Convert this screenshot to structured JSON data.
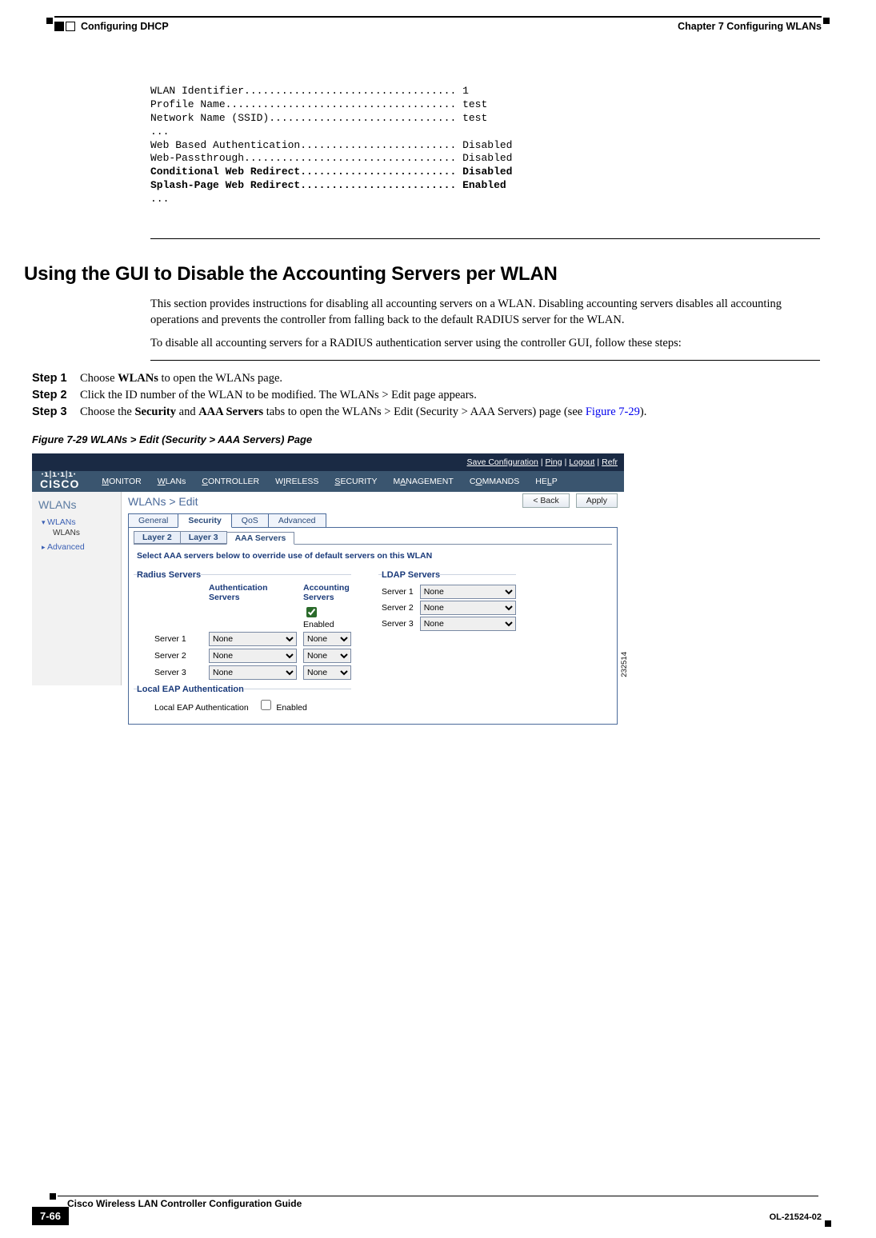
{
  "header": {
    "chapter": "Chapter 7      Configuring WLANs",
    "section": "Configuring DHCP"
  },
  "cli": {
    "plain": "WLAN Identifier.................................. 1\nProfile Name..................................... test\nNetwork Name (SSID).............................. test\n...\nWeb Based Authentication......................... Disabled\nWeb-Passthrough.................................. Disabled",
    "bold": "Conditional Web Redirect......................... Disabled\nSplash-Page Web Redirect......................... Enabled",
    "tail": "..."
  },
  "title": "Using the GUI to Disable the Accounting Servers per WLAN",
  "para1": "This section provides instructions for disabling all accounting servers on a WLAN. Disabling accounting servers disables all accounting operations and prevents the controller from falling back to the default RADIUS server for the WLAN.",
  "para2": "To disable all accounting servers for a RADIUS authentication server using the controller GUI, follow these steps:",
  "steps": {
    "s1l": "Step 1",
    "s1t_a": "Choose ",
    "s1t_b": "WLANs",
    "s1t_c": " to open the WLANs page.",
    "s2l": "Step 2",
    "s2t": "Click the ID number of the WLAN to be modified. The WLANs > Edit page appears.",
    "s3l": "Step 3",
    "s3t_a": "Choose the ",
    "s3t_b": "Security",
    "s3t_c": " and ",
    "s3t_d": "AAA Servers",
    "s3t_e": " tabs to open the WLANs > Edit (Security > AAA Servers) page (see ",
    "s3t_link": "Figure 7-29",
    "s3t_f": ")."
  },
  "figcap": "Figure 7-29   WLANs > Edit (Security > AAA Servers) Page",
  "fig": {
    "toplinks": {
      "save": "Save Configuration",
      "ping": "Ping",
      "logout": "Logout",
      "refr": "Refr"
    },
    "brand": "CISCO",
    "nav": [
      "MONITOR",
      "WLANs",
      "CONTROLLER",
      "WIRELESS",
      "SECURITY",
      "MANAGEMENT",
      "COMMANDS",
      "HELP"
    ],
    "side": {
      "title": "WLANs",
      "g1": "WLANs",
      "g1s": "WLANs",
      "g2": "Advanced"
    },
    "crumb": "WLANs > Edit",
    "back": "< Back",
    "apply": "Apply",
    "tabs": [
      "General",
      "Security",
      "QoS",
      "Advanced"
    ],
    "itabs": [
      "Layer 2",
      "Layer 3",
      "AAA Servers"
    ],
    "override": "Select AAA servers below to override use of default servers on this WLAN",
    "radius": "Radius Servers",
    "auth_h": "Authentication Servers",
    "acct_h": "Accounting Servers",
    "enabled": "Enabled",
    "srv1": "Server 1",
    "srv2": "Server 2",
    "srv3": "Server 3",
    "none": "None",
    "ldap": "LDAP Servers",
    "leap_legend": "Local EAP Authentication",
    "leap_lbl": "Local EAP Authentication",
    "id": "232514"
  },
  "footer": {
    "guide": "Cisco Wireless LAN Controller Configuration Guide",
    "page": "7-66",
    "doc": "OL-21524-02"
  }
}
